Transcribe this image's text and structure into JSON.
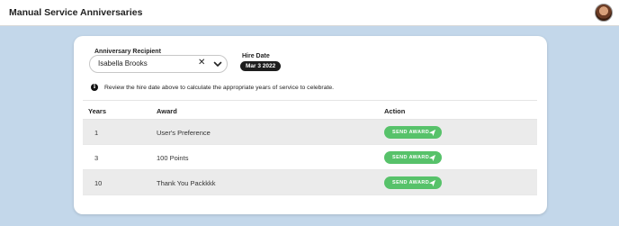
{
  "header": {
    "title": "Manual Service Anniversaries",
    "avatar_icon": "user-avatar"
  },
  "form": {
    "recipient_label": "Anniversary Recipient",
    "recipient_value": "Isabella Brooks",
    "clear_icon": "close-icon",
    "dropdown_icon": "chevron-down-icon",
    "hire_date_label": "Hire Date",
    "hire_date_value": "Mar 3 2022"
  },
  "info": {
    "icon": "info-icon",
    "text": "Review the hire date above to calculate the appropriate years of service to celebrate."
  },
  "table": {
    "headers": [
      "Years",
      "Award",
      "Action"
    ],
    "rows": [
      {
        "years": "1",
        "award": "User's Preference",
        "action": "SEND AWARD"
      },
      {
        "years": "3",
        "award": "100 Points",
        "action": "SEND AWARD"
      },
      {
        "years": "10",
        "award": "Thank You Packkkk",
        "action": "SEND AWARD"
      }
    ]
  },
  "colors": {
    "background": "#c3d7ea",
    "accent_green": "#57c26a",
    "badge_dark": "#1e1e1e",
    "row_shade": "#ebebeb"
  }
}
